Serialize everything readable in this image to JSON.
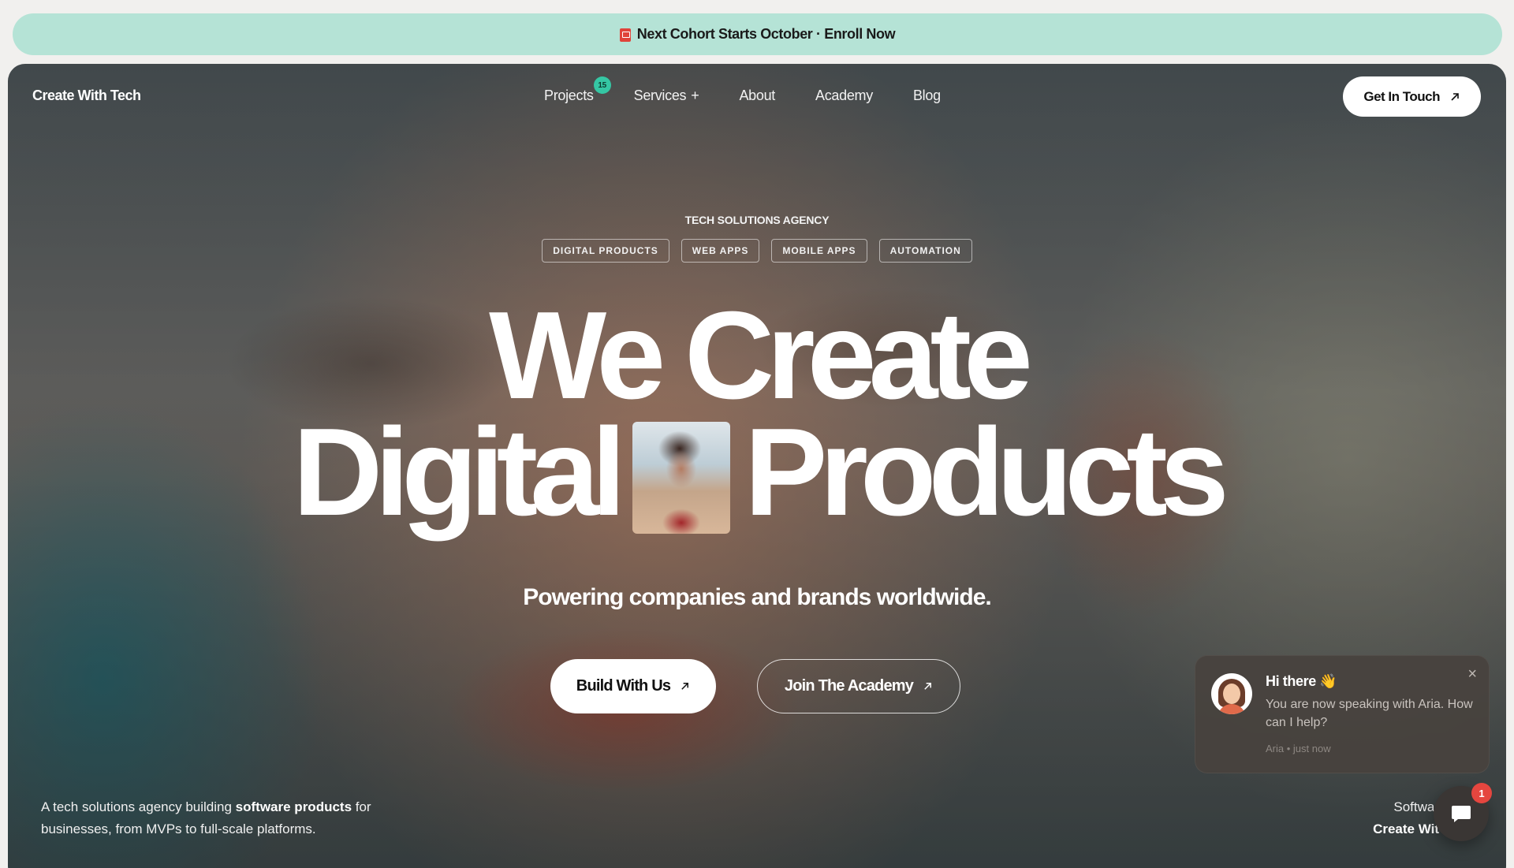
{
  "announcement": {
    "icon": "ticket-icon",
    "text": "Next Cohort Starts October · Enroll Now"
  },
  "nav": {
    "brand": "Create With Tech",
    "items": [
      {
        "label": "Projects",
        "badge": "15"
      },
      {
        "label": "Services",
        "suffix": "+"
      },
      {
        "label": "About"
      },
      {
        "label": "Academy"
      },
      {
        "label": "Blog"
      }
    ],
    "cta": "Get In Touch"
  },
  "hero": {
    "eyebrow": "TECH SOLUTIONS AGENCY",
    "tags": [
      "DIGITAL PRODUCTS",
      "WEB APPS",
      "MOBILE APPS",
      "AUTOMATION"
    ],
    "headline_line1": "We Create",
    "headline_word1": "Digital",
    "headline_word2": "Products",
    "subtitle": "Powering companies and brands worldwide.",
    "primary_button": "Build With Us",
    "secondary_button": "Join The Academy",
    "description_pre": "A tech solutions agency building ",
    "description_bold": "software products",
    "description_post": " for businesses, from MVPs to full-scale platforms.",
    "corner_line1": "Softwar",
    "corner_line2": "Create Wit"
  },
  "chat": {
    "title": "Hi there 👋",
    "message": "You are now speaking with Aria. How can I help?",
    "meta": "Aria • just now",
    "unread": "1"
  },
  "colors": {
    "banner": "#b5e3d6",
    "badge": "#35c7a4",
    "notification": "#e5463f"
  }
}
